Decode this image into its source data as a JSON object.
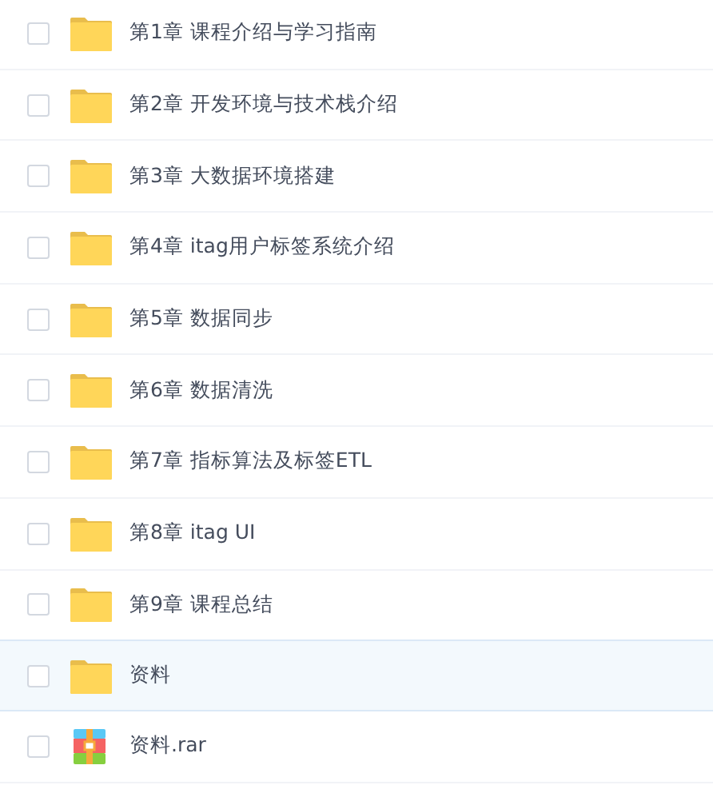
{
  "files": [
    {
      "name": "第1章 课程介绍与学习指南",
      "kind": "folder",
      "checked": false,
      "selected": false
    },
    {
      "name": "第2章 开发环境与技术栈介绍",
      "kind": "folder",
      "checked": false,
      "selected": false
    },
    {
      "name": "第3章 大数据环境搭建",
      "kind": "folder",
      "checked": false,
      "selected": false
    },
    {
      "name": "第4章 itag用户标签系统介绍",
      "kind": "folder",
      "checked": false,
      "selected": false
    },
    {
      "name": "第5章 数据同步",
      "kind": "folder",
      "checked": false,
      "selected": false
    },
    {
      "name": "第6章 数据清洗",
      "kind": "folder",
      "checked": false,
      "selected": false
    },
    {
      "name": "第7章 指标算法及标签ETL",
      "kind": "folder",
      "checked": false,
      "selected": false
    },
    {
      "name": "第8章 itag UI",
      "kind": "folder",
      "checked": false,
      "selected": false
    },
    {
      "name": "第9章 课程总结",
      "kind": "folder",
      "checked": false,
      "selected": false
    },
    {
      "name": "资料",
      "kind": "folder",
      "checked": false,
      "selected": true
    },
    {
      "name": "资料.rar",
      "kind": "archive",
      "checked": false,
      "selected": false
    }
  ]
}
